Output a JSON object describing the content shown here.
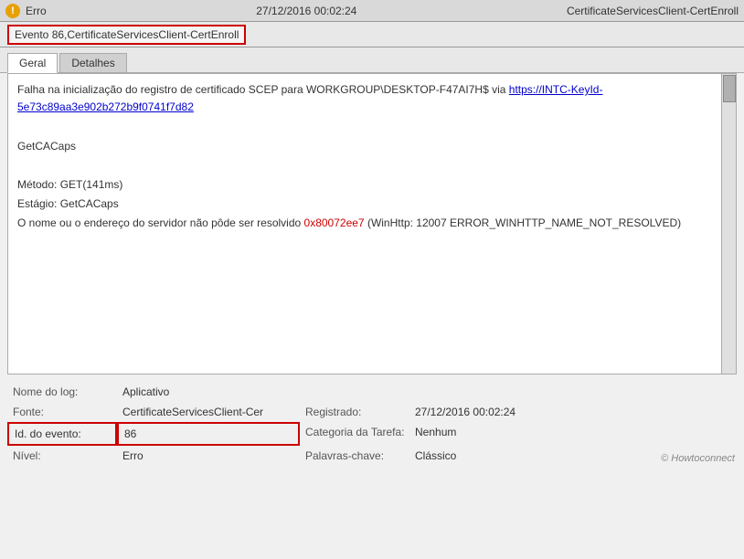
{
  "titlebar": {
    "icon_label": "!",
    "left": "Erro",
    "center": "27/12/2016 00:02:24",
    "right": "CertificateServicesClient-CertEnroll"
  },
  "event_header": {
    "title": "Evento 86,CertificateServicesClient-CertEnroll"
  },
  "tabs": [
    {
      "label": "Geral",
      "active": true
    },
    {
      "label": "Detalhes",
      "active": false
    }
  ],
  "content": {
    "line1_prefix": "Falha na inicialização do registro de certificado SCEP para WORKGROUP\\DESKTOP-F47AI7H$ via ",
    "line1_link": "https://INTC-KeyId-5e73c89aa3e902b272b9f0741f7d82",
    "line2": "",
    "line3": "GetCACaps",
    "line4": "",
    "line5": "Método: GET(141ms)",
    "line6": "Estágio: GetCACaps",
    "line7_prefix": "O nome ou o endereço do servidor não pôde ser resolvido ",
    "line7_error": "0x80072ee7",
    "line7_suffix": " (WinHttp: 12007 ERROR_WINHTTP_NAME_NOT_RESOLVED)"
  },
  "details": {
    "log_label": "Nome do log:",
    "log_value": "Aplicativo",
    "source_label": "Fonte:",
    "source_value": "CertificateServicesClient-Cer",
    "registered_label": "Registrado:",
    "registered_value": "27/12/2016 00:02:24",
    "event_id_label": "Id. do evento:",
    "event_id_value": "86",
    "task_label": "Categoria da Tarefa:",
    "task_value": "Nenhum",
    "level_label": "Nível:",
    "level_value": "Erro",
    "keywords_label": "Palavras-chave:",
    "keywords_value": "Clássico"
  },
  "watermark": "© Howtoconnect"
}
